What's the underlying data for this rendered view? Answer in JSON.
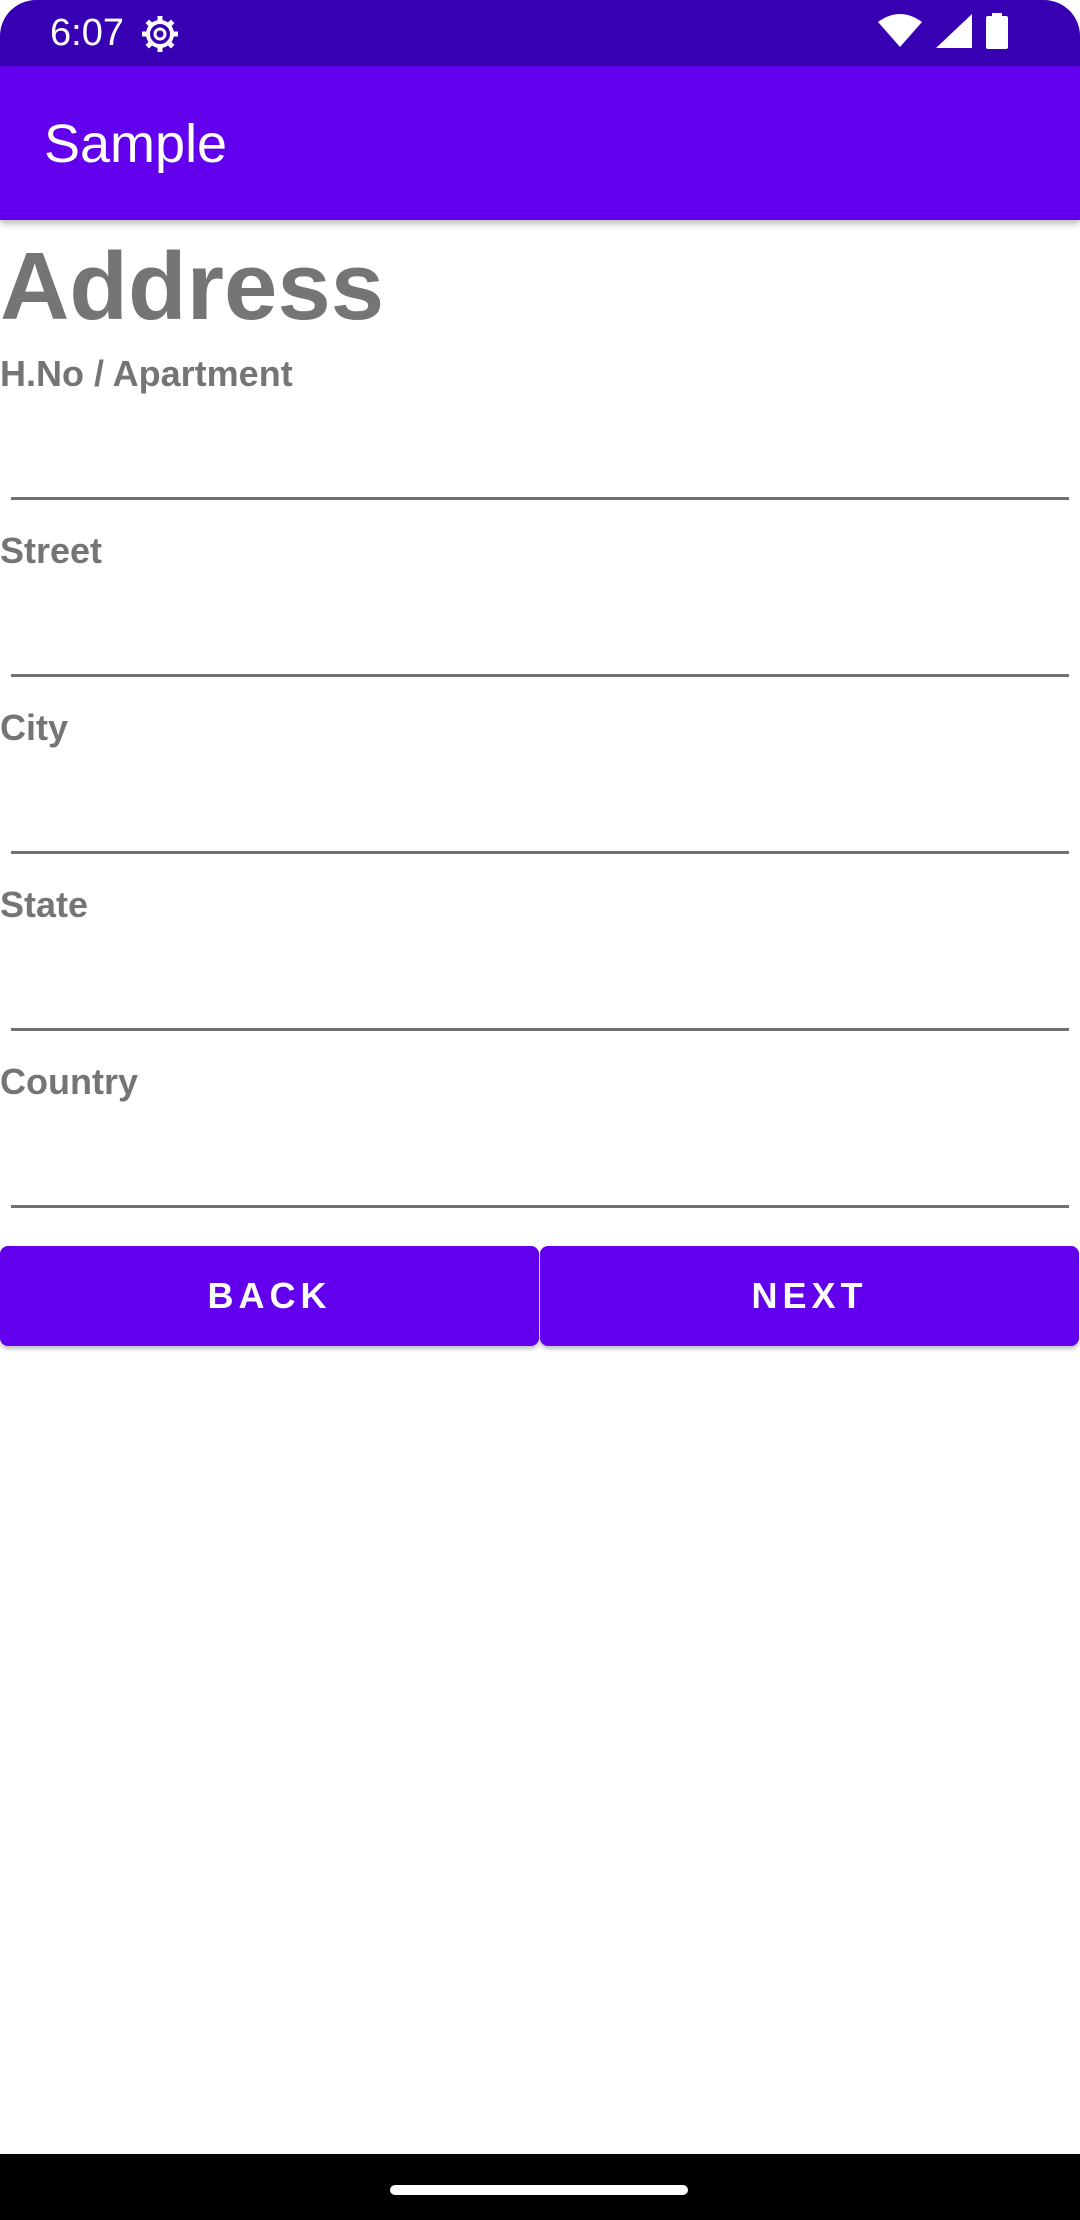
{
  "status_bar": {
    "time": "6:07",
    "icons": [
      "settings-gear-icon",
      "wifi-icon",
      "cellular-signal-icon",
      "battery-icon"
    ]
  },
  "app_bar": {
    "title": "Sample"
  },
  "form": {
    "heading": "Address",
    "fields": [
      {
        "label": "H.No / Apartment",
        "value": ""
      },
      {
        "label": "Street",
        "value": ""
      },
      {
        "label": "City",
        "value": ""
      },
      {
        "label": "State",
        "value": ""
      },
      {
        "label": "Country",
        "value": ""
      }
    ],
    "back_label": "BACK",
    "next_label": "NEXT"
  },
  "colors": {
    "status_bar": "#3700b3",
    "primary": "#6200ee",
    "label_text": "#757575",
    "underline": "#6f6f6f"
  }
}
